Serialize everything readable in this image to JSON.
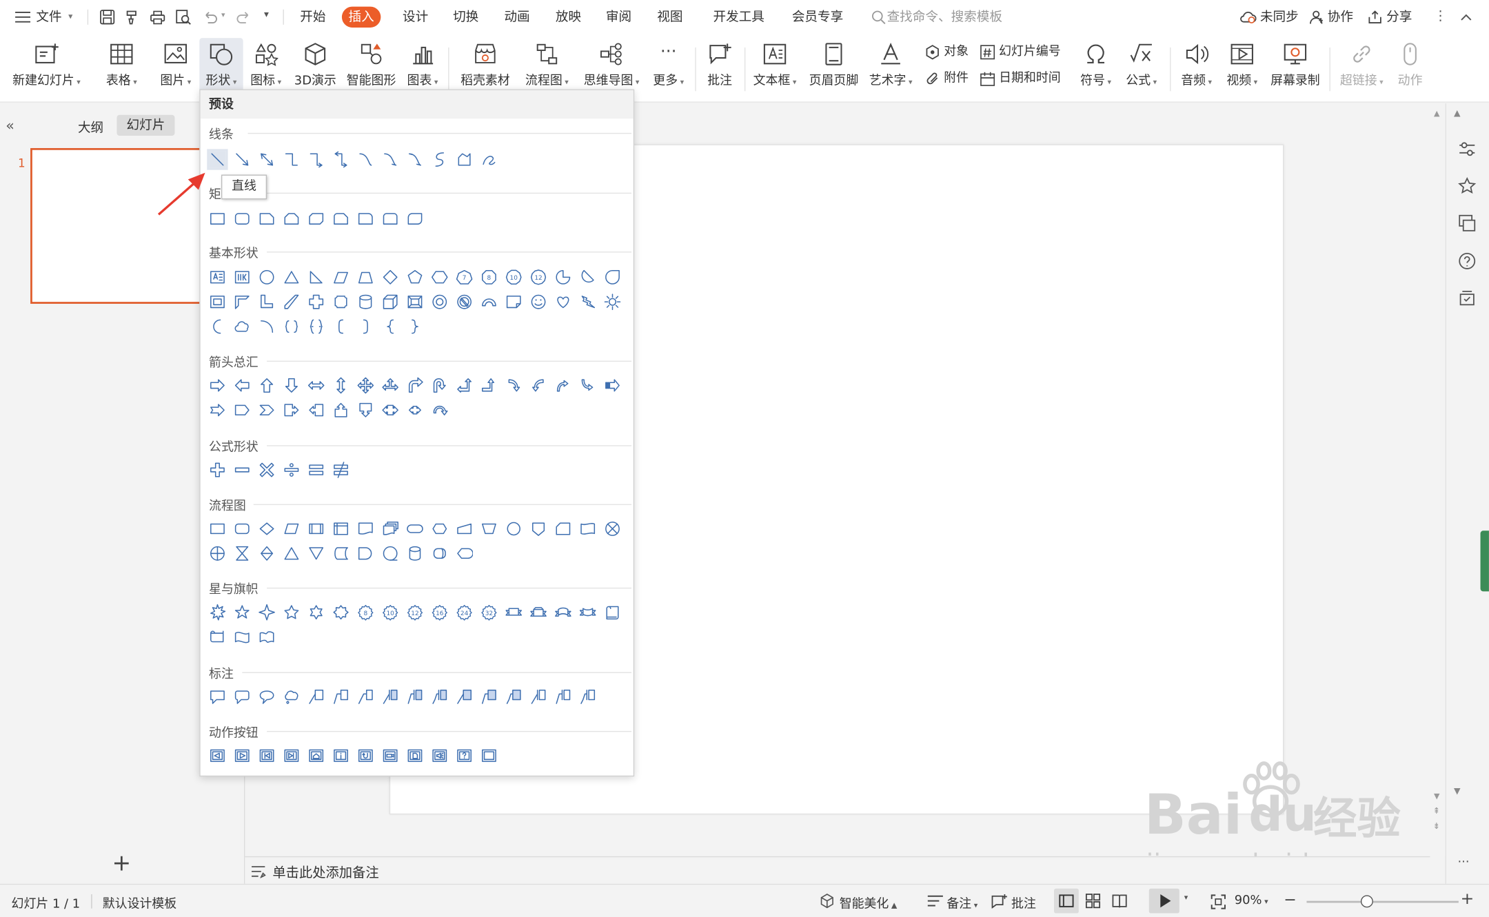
{
  "menu": {
    "file_label": "文件",
    "tabs": [
      "开始",
      "插入",
      "设计",
      "切换",
      "动画",
      "放映",
      "审阅",
      "视图",
      "开发工具",
      "会员专享"
    ],
    "search_placeholder": "查找命令、搜索模板",
    "sync": "未同步",
    "collab": "协作",
    "share": "分享"
  },
  "ribbon": {
    "new_slide": "新建幻灯片",
    "table": "表格",
    "picture": "图片",
    "shape": "形状",
    "icon": "图标",
    "threed": "3D演示",
    "smartart": "智能图形",
    "chart": "图表",
    "daoke": "稻壳素材",
    "flowchart": "流程图",
    "mindmap": "思维导图",
    "more": "更多",
    "comment": "批注",
    "textbox": "文本框",
    "header_footer": "页眉页脚",
    "wordart": "艺术字",
    "object": "对象",
    "slide_number": "幻灯片编号",
    "attachment": "附件",
    "datetime": "日期和时间",
    "symbol": "符号",
    "formula": "公式",
    "audio": "音频",
    "video": "视频",
    "screen_record": "屏幕录制",
    "hyperlink": "超链接",
    "action": "动作"
  },
  "panel": {
    "tab_outline": "大纲",
    "tab_slides": "幻灯片",
    "slide_number": "1",
    "add": "+"
  },
  "notes_placeholder": "单击此处添加备注",
  "dropdown": {
    "header": "预设",
    "tooltip": "直线",
    "sections": {
      "lines": "线条",
      "rect": "矩形",
      "basic": "基本形状",
      "arrows": "箭头总汇",
      "formula": "公式形状",
      "flow": "流程图",
      "stars": "星与旗帜",
      "callouts": "标注",
      "actions": "动作按钮"
    },
    "num_badges": [
      "7",
      "8",
      "10",
      "12"
    ],
    "star_badges": [
      "8",
      "10",
      "12",
      "16",
      "24",
      "32"
    ]
  },
  "status": {
    "slide_info": "幻灯片 1 / 1",
    "template": "默认设计模板",
    "smart_beautify": "智能美化",
    "notes": "备注",
    "comments": "批注",
    "zoom": "90%"
  },
  "watermark": {
    "brand_left": "Bai",
    "brand_right": "du",
    "cn": "经验",
    "url": "jingyan.baidu.com"
  },
  "colors": {
    "accent": "#ec5d29",
    "shape_stroke": "#3e6fb0",
    "annotation_arrow": "#e63a2e"
  }
}
